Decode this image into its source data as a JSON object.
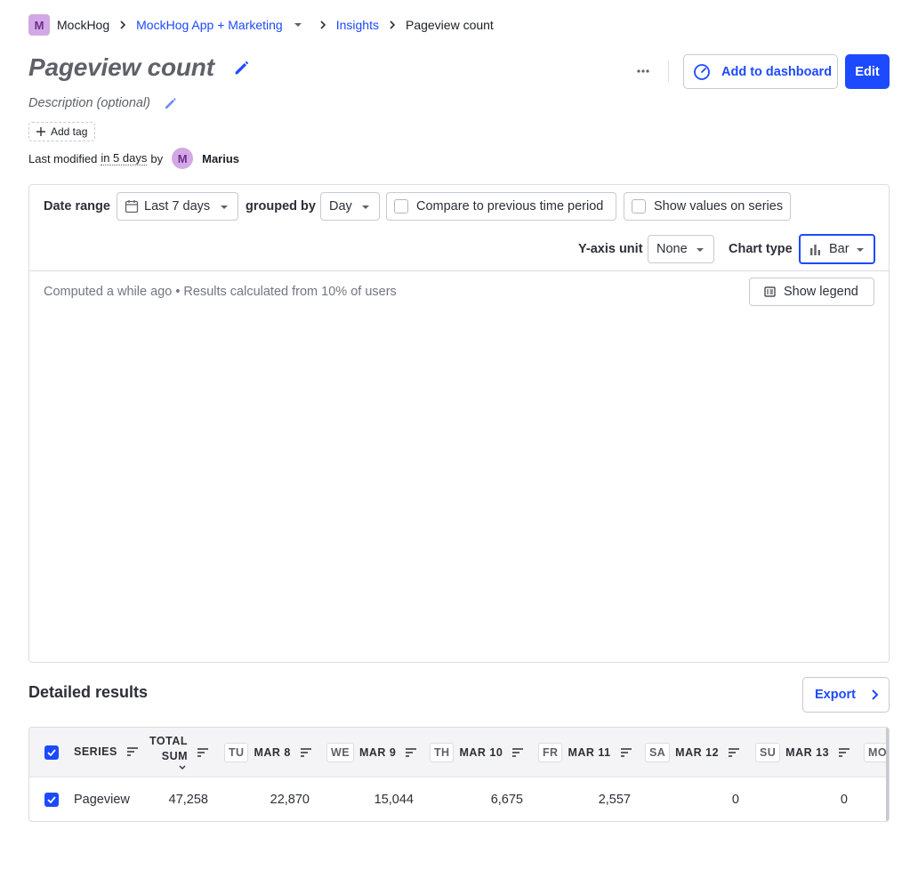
{
  "breadcrumb": {
    "org_initial": "M",
    "org_name": "MockHog",
    "project": "MockHog App + Marketing",
    "section": "Insights",
    "current": "Pageview count"
  },
  "header": {
    "title": "Pageview count",
    "description_placeholder": "Description (optional)",
    "add_tag_label": "Add tag",
    "modified_prefix": "Last modified",
    "modified_time": "in 5 days",
    "modified_by": "by",
    "user_initial": "M",
    "user_name": "Marius",
    "add_to_dashboard_label": "Add to dashboard",
    "edit_label": "Edit"
  },
  "controls": {
    "date_range_label": "Date range",
    "date_range_value": "Last 7 days",
    "grouped_by_label": "grouped by",
    "interval_value": "Day",
    "compare_label": "Compare to previous time period",
    "show_values_label": "Show values on series",
    "y_axis_label": "Y-axis unit",
    "y_axis_value": "None",
    "chart_type_label": "Chart type",
    "chart_type_value": "Bar"
  },
  "results": {
    "computed_text": "Computed a while ago • Results calculated from 10% of users",
    "show_legend_label": "Show legend"
  },
  "detailed": {
    "title": "Detailed results",
    "export_label": "Export",
    "headers": {
      "series": "SERIES",
      "total_line1": "TOTAL",
      "total_line2": "SUM",
      "days": [
        {
          "dow": "TU",
          "date": "MAR 8"
        },
        {
          "dow": "WE",
          "date": "MAR 9"
        },
        {
          "dow": "TH",
          "date": "MAR 10"
        },
        {
          "dow": "FR",
          "date": "MAR 11"
        },
        {
          "dow": "SA",
          "date": "MAR 12"
        },
        {
          "dow": "SU",
          "date": "MAR 13"
        },
        {
          "dow": "MO",
          "date": ""
        }
      ]
    },
    "row": {
      "series": "Pageview",
      "total": "47,258",
      "values": [
        "22,870",
        "15,044",
        "6,675",
        "2,557",
        "0",
        "0"
      ]
    }
  },
  "colors": {
    "primary": "#1d4aff",
    "avatar_bg": "#d3a8e6",
    "muted_text": "#747680"
  }
}
